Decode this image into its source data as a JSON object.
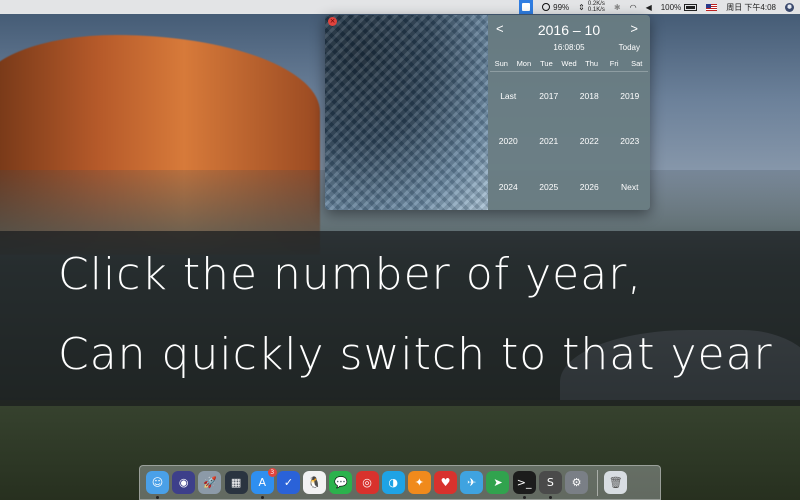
{
  "menubar": {
    "battery_status": "99%",
    "net_up": "0.2K/s",
    "net_down": "0.1K/s",
    "battery_percent": "100%",
    "clock": "周日 下午4:08"
  },
  "calendar": {
    "prev": "<",
    "next": ">",
    "title": "2016 – 10",
    "time": "16:08:05",
    "today": "Today",
    "close": "×",
    "weekdays": [
      "Sun",
      "Mon",
      "Tue",
      "Wed",
      "Thu",
      "Fri",
      "Sat"
    ],
    "year_cells": [
      "Last",
      "2017",
      "2018",
      "2019",
      "2020",
      "2021",
      "2022",
      "2023",
      "2024",
      "2025",
      "2026",
      "Next"
    ]
  },
  "caption": {
    "line1": "Click the number of year,",
    "line2": "Can quickly switch to that year"
  },
  "dock": {
    "apps": [
      {
        "name": "finder-icon",
        "color": "#4aa0e8",
        "glyph": "☺",
        "running": true
      },
      {
        "name": "siri-icon",
        "color": "#3d3f8a",
        "glyph": "◉",
        "running": false
      },
      {
        "name": "launchpad-icon",
        "color": "#8c9aa8",
        "glyph": "🚀",
        "running": false
      },
      {
        "name": "mission-control-icon",
        "color": "#2a3440",
        "glyph": "▦",
        "running": false
      },
      {
        "name": "app-store-icon",
        "color": "#2f8ff0",
        "glyph": "A",
        "running": true,
        "badge": "3"
      },
      {
        "name": "shield-app-icon",
        "color": "#2a62d8",
        "glyph": "✓",
        "running": false
      },
      {
        "name": "qq-icon",
        "color": "#f2f2f2",
        "glyph": "🐧",
        "running": false
      },
      {
        "name": "wechat-icon",
        "color": "#2bb24c",
        "glyph": "💬",
        "running": false
      },
      {
        "name": "netease-music-icon",
        "color": "#d8322d",
        "glyph": "◎",
        "running": false
      },
      {
        "name": "browser-icon",
        "color": "#1fa3e5",
        "glyph": "◑",
        "running": false
      },
      {
        "name": "fox-app-icon",
        "color": "#f08a1c",
        "glyph": "✦",
        "running": false
      },
      {
        "name": "cards-app-icon",
        "color": "#d8322d",
        "glyph": "♥",
        "running": false
      },
      {
        "name": "xcode-bird-icon",
        "color": "#3fa3e0",
        "glyph": "✈",
        "running": false
      },
      {
        "name": "telegram-icon",
        "color": "#31a34e",
        "glyph": "➤",
        "running": false
      },
      {
        "name": "terminal-icon",
        "color": "#1c1c1c",
        "glyph": ">_",
        "running": true
      },
      {
        "name": "sublime-icon",
        "color": "#4a4a4a",
        "glyph": "S",
        "running": true
      },
      {
        "name": "system-preferences-icon",
        "color": "#7a7f86",
        "glyph": "⚙",
        "running": false
      }
    ],
    "trash": {
      "name": "trash-icon",
      "color": "#d8dde2",
      "glyph": "🗑"
    }
  }
}
